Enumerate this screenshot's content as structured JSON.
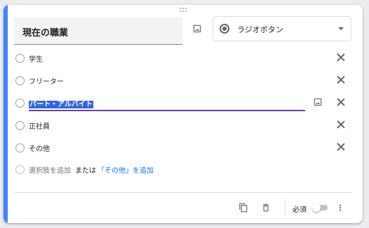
{
  "question": {
    "title": "現在の職業",
    "type_label": "ラジオボタン"
  },
  "options": [
    {
      "label": "学生"
    },
    {
      "label": "フリーター"
    },
    {
      "label": "パート・アルバイト",
      "editing": true
    },
    {
      "label": "正社員"
    },
    {
      "label": "その他"
    }
  ],
  "add_option": {
    "add_label": "選択肢を追加",
    "or_label": "または",
    "add_other_label": "「その他」を追加"
  },
  "footer": {
    "required_label": "必須",
    "required_on": false
  },
  "colors": {
    "accent": "#4285f4",
    "selection": "#3367d6",
    "focus_underline": "#673ab7",
    "link": "#1a73e8"
  },
  "icons": [
    "drag-handle-icon",
    "image-icon",
    "radio-icon",
    "dropdown-arrow-icon",
    "close-icon",
    "copy-icon",
    "delete-icon",
    "more-vert-icon"
  ]
}
